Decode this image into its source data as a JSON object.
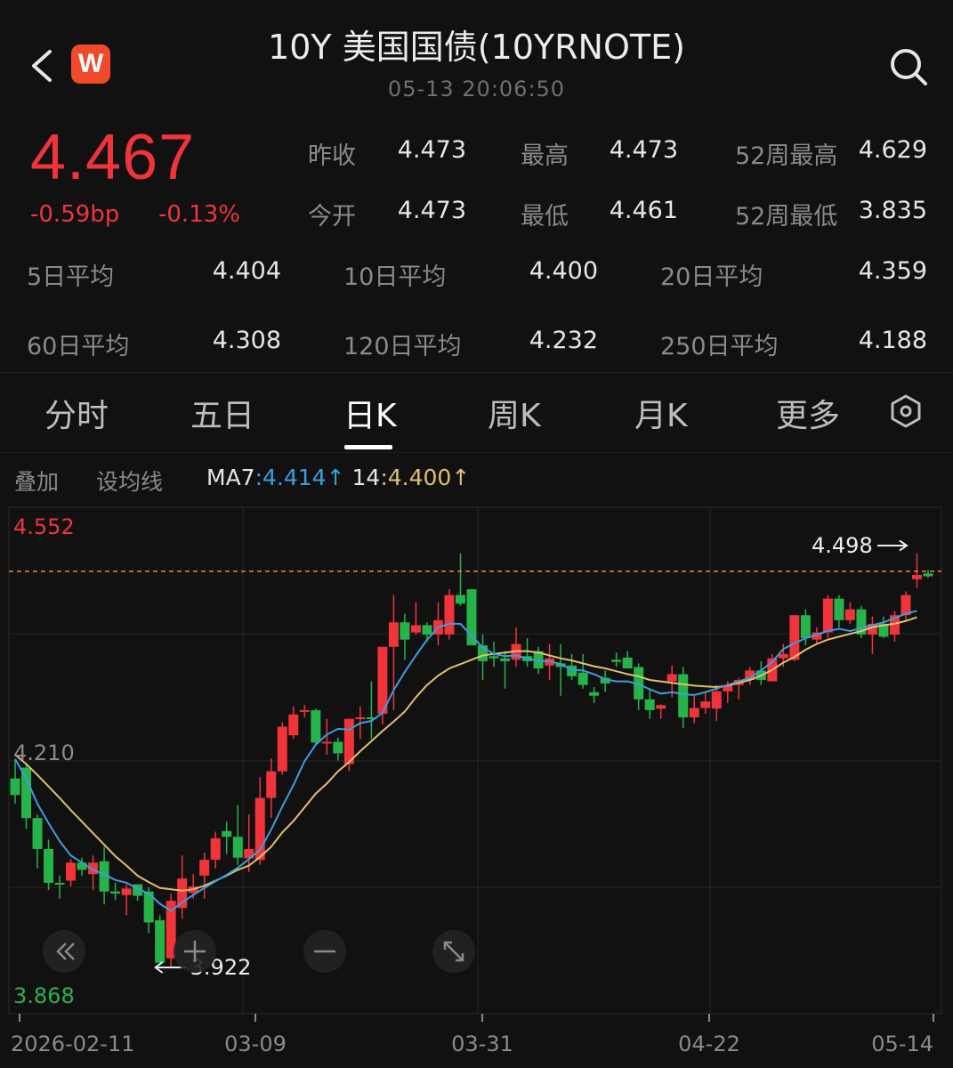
{
  "header": {
    "title": "10Y 美国国债(10YRNOTE)",
    "datetime": "05-13 20:06:50",
    "logo_text": "W"
  },
  "quote": {
    "price": "4.467",
    "change_bp": "-0.59bp",
    "change_pct": "-0.13%",
    "price_color": "#f0343a",
    "stats": [
      {
        "label": "昨收",
        "value": "4.473"
      },
      {
        "label": "最高",
        "value": "4.473"
      },
      {
        "label": "52周最高",
        "value": "4.629"
      },
      {
        "label": "今开",
        "value": "4.473"
      },
      {
        "label": "最低",
        "value": "4.461"
      },
      {
        "label": "52周最低",
        "value": "3.835"
      }
    ],
    "averages": [
      {
        "label": "5日平均",
        "value": "4.404"
      },
      {
        "label": "10日平均",
        "value": "4.400"
      },
      {
        "label": "20日平均",
        "value": "4.359"
      },
      {
        "label": "60日平均",
        "value": "4.308"
      },
      {
        "label": "120日平均",
        "value": "4.232"
      },
      {
        "label": "250日平均",
        "value": "4.188"
      }
    ]
  },
  "tabs": [
    "分时",
    "五日",
    "日K",
    "周K",
    "月K",
    "更多"
  ],
  "active_tab": "日K",
  "chart_toolbar": {
    "overlay_label": "叠加",
    "ma_settings_label": "设均线",
    "ma7_label": "MA7",
    "ma7_value": "4.414↑",
    "ma14_label": "14",
    "ma14_value": "4.400↑",
    "ma7_color": "#3a9ee0",
    "ma14_color": "#e2c069"
  },
  "chart_data": {
    "type": "candlestick",
    "y_axis_labels": [
      "4.552",
      "4.210",
      "3.868"
    ],
    "ylim": [
      3.868,
      4.552
    ],
    "x_tick_labels": [
      "2026-02-11",
      "03-09",
      "03-31",
      "04-22",
      "05-14"
    ],
    "reference_line_value": 4.473,
    "high_marker": "4.498",
    "low_marker": "3.922",
    "up_color": "#f0343a",
    "down_color": "#26b34a",
    "ohlc": [
      [
        4.185,
        4.212,
        4.15,
        4.162
      ],
      [
        4.2,
        4.205,
        4.115,
        4.13
      ],
      [
        4.13,
        4.135,
        4.06,
        4.087
      ],
      [
        4.087,
        4.1,
        4.03,
        4.04
      ],
      [
        4.04,
        4.05,
        4.018,
        4.038
      ],
      [
        4.043,
        4.073,
        4.035,
        4.068
      ],
      [
        4.068,
        4.075,
        4.05,
        4.058
      ],
      [
        4.052,
        4.078,
        4.03,
        4.068
      ],
      [
        4.07,
        4.09,
        4.01,
        4.028
      ],
      [
        4.028,
        4.04,
        4.016,
        4.025
      ],
      [
        4.023,
        4.038,
        3.995,
        4.032
      ],
      [
        4.038,
        4.038,
        4.015,
        4.022
      ],
      [
        4.028,
        4.034,
        3.97,
        3.985
      ],
      [
        3.988,
        3.995,
        3.925,
        3.929
      ],
      [
        3.935,
        4.025,
        3.922,
        4.015
      ],
      [
        4.005,
        4.078,
        3.99,
        4.046
      ],
      [
        4.026,
        4.052,
        4.018,
        4.035
      ],
      [
        4.05,
        4.082,
        4.018,
        4.072
      ],
      [
        4.072,
        4.111,
        4.06,
        4.102
      ],
      [
        4.112,
        4.125,
        4.08,
        4.104
      ],
      [
        4.104,
        4.148,
        4.065,
        4.075
      ],
      [
        4.074,
        4.135,
        4.055,
        4.087
      ],
      [
        4.072,
        4.187,
        4.065,
        4.158
      ],
      [
        4.158,
        4.213,
        4.13,
        4.195
      ],
      [
        4.195,
        4.263,
        4.19,
        4.257
      ],
      [
        4.245,
        4.285,
        4.24,
        4.274
      ],
      [
        4.278,
        4.287,
        4.27,
        4.28
      ],
      [
        4.28,
        4.282,
        4.23,
        4.235
      ],
      [
        4.235,
        4.268,
        4.218,
        4.236
      ],
      [
        4.236,
        4.242,
        4.21,
        4.22
      ],
      [
        4.205,
        4.265,
        4.195,
        4.268
      ],
      [
        4.268,
        4.285,
        4.24,
        4.27
      ],
      [
        4.27,
        4.32,
        4.24,
        4.268
      ],
      [
        4.275,
        4.366,
        4.26,
        4.368
      ],
      [
        4.368,
        4.44,
        4.28,
        4.402
      ],
      [
        4.402,
        4.414,
        4.35,
        4.378
      ],
      [
        4.388,
        4.43,
        4.385,
        4.398
      ],
      [
        4.398,
        4.402,
        4.375,
        4.385
      ],
      [
        4.385,
        4.43,
        4.37,
        4.405
      ],
      [
        4.385,
        4.448,
        4.378,
        4.44
      ],
      [
        4.44,
        4.498,
        4.425,
        4.428
      ],
      [
        4.448,
        4.448,
        4.37,
        4.37
      ],
      [
        4.37,
        4.385,
        4.322,
        4.348
      ],
      [
        4.355,
        4.375,
        4.34,
        4.352
      ],
      [
        4.352,
        4.362,
        4.31,
        4.348
      ],
      [
        4.35,
        4.395,
        4.34,
        4.372
      ],
      [
        4.355,
        4.38,
        4.34,
        4.348
      ],
      [
        4.362,
        4.368,
        4.33,
        4.338
      ],
      [
        4.342,
        4.372,
        4.322,
        4.352
      ],
      [
        4.345,
        4.372,
        4.3,
        4.34
      ],
      [
        4.342,
        4.358,
        4.322,
        4.327
      ],
      [
        4.332,
        4.358,
        4.31,
        4.315
      ],
      [
        4.305,
        4.312,
        4.29,
        4.3
      ],
      [
        4.325,
        4.335,
        4.305,
        4.317
      ],
      [
        4.35,
        4.36,
        4.34,
        4.347
      ],
      [
        4.353,
        4.362,
        4.338,
        4.338
      ],
      [
        4.34,
        4.345,
        4.28,
        4.295
      ],
      [
        4.295,
        4.31,
        4.268,
        4.28
      ],
      [
        4.282,
        4.288,
        4.268,
        4.287
      ],
      [
        4.32,
        4.342,
        4.298,
        4.33
      ],
      [
        4.33,
        4.34,
        4.255,
        4.27
      ],
      [
        4.27,
        4.3,
        4.262,
        4.283
      ],
      [
        4.283,
        4.305,
        4.275,
        4.292
      ],
      [
        4.282,
        4.315,
        4.265,
        4.306
      ],
      [
        4.306,
        4.32,
        4.29,
        4.315
      ],
      [
        4.315,
        4.325,
        4.295,
        4.322
      ],
      [
        4.322,
        4.34,
        4.315,
        4.335
      ],
      [
        4.335,
        4.348,
        4.315,
        4.322
      ],
      [
        4.32,
        4.358,
        4.32,
        4.352
      ],
      [
        4.352,
        4.372,
        4.34,
        4.358
      ],
      [
        4.35,
        4.41,
        4.348,
        4.412
      ],
      [
        4.412,
        4.42,
        4.37,
        4.38
      ],
      [
        4.378,
        4.395,
        4.372,
        4.388
      ],
      [
        4.388,
        4.44,
        4.38,
        4.435
      ],
      [
        4.435,
        4.44,
        4.395,
        4.405
      ],
      [
        4.405,
        4.43,
        4.4,
        4.42
      ],
      [
        4.42,
        4.425,
        4.38,
        4.385
      ],
      [
        4.385,
        4.41,
        4.358,
        4.4
      ],
      [
        4.4,
        4.41,
        4.38,
        4.382
      ],
      [
        4.385,
        4.418,
        4.375,
        4.412
      ],
      [
        4.412,
        4.445,
        4.405,
        4.44
      ],
      [
        4.462,
        4.498,
        4.45,
        4.468
      ],
      [
        4.47,
        4.475,
        4.464,
        4.466
      ]
    ],
    "ma7": [
      4.212,
      4.185,
      4.15,
      4.123,
      4.098,
      4.078,
      4.068,
      4.058,
      4.052,
      4.044,
      4.04,
      4.032,
      4.025,
      4.011,
      4.001,
      4.013,
      4.023,
      4.033,
      4.042,
      4.051,
      4.061,
      4.073,
      4.086,
      4.114,
      4.146,
      4.176,
      4.209,
      4.232,
      4.246,
      4.254,
      4.253,
      4.262,
      4.265,
      4.276,
      4.308,
      4.333,
      4.356,
      4.378,
      4.395,
      4.4,
      4.4,
      4.383,
      4.367,
      4.358,
      4.355,
      4.356,
      4.352,
      4.348,
      4.348,
      4.344,
      4.336,
      4.335,
      4.33,
      4.323,
      4.32,
      4.32,
      4.316,
      4.309,
      4.303,
      4.305,
      4.302,
      4.301,
      4.305,
      4.31,
      4.315,
      4.32,
      4.325,
      4.335,
      4.347,
      4.365,
      4.373,
      4.38,
      4.385,
      4.39,
      4.393,
      4.39,
      4.394,
      4.398,
      4.402,
      4.408,
      4.414,
      4.418
    ],
    "ma14": [
      4.218,
      4.205,
      4.19,
      4.174,
      4.158,
      4.141,
      4.125,
      4.109,
      4.093,
      4.077,
      4.064,
      4.05,
      4.041,
      4.033,
      4.031,
      4.029,
      4.031,
      4.036,
      4.043,
      4.05,
      4.058,
      4.064,
      4.076,
      4.09,
      4.11,
      4.126,
      4.145,
      4.164,
      4.178,
      4.195,
      4.208,
      4.223,
      4.237,
      4.251,
      4.264,
      4.278,
      4.298,
      4.315,
      4.328,
      4.338,
      4.344,
      4.35,
      4.356,
      4.358,
      4.36,
      4.362,
      4.362,
      4.36,
      4.356,
      4.352,
      4.349,
      4.345,
      4.341,
      4.338,
      4.334,
      4.33,
      4.327,
      4.322,
      4.32,
      4.318,
      4.316,
      4.314,
      4.313,
      4.312,
      4.314,
      4.318,
      4.322,
      4.328,
      4.336,
      4.346,
      4.354,
      4.364,
      4.372,
      4.378,
      4.382,
      4.386,
      4.39,
      4.395,
      4.398,
      4.4,
      4.404,
      4.409
    ]
  }
}
